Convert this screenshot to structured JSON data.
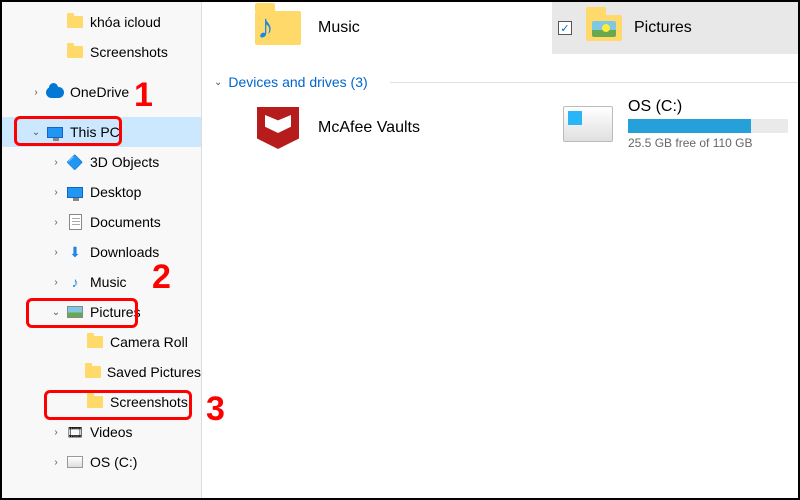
{
  "sidebar": {
    "items": [
      {
        "label": "khóa icloud",
        "indent": 2,
        "icon": "folder",
        "chev": ""
      },
      {
        "label": "Screenshots",
        "indent": 2,
        "icon": "folder",
        "chev": ""
      },
      {
        "label": "OneDrive",
        "indent": 1,
        "icon": "onedrive",
        "chev": "›"
      },
      {
        "label": "This PC",
        "indent": 1,
        "icon": "monitor",
        "chev": "⌄",
        "selected": true
      },
      {
        "label": "3D Objects",
        "indent": 2,
        "icon": "cube",
        "chev": "›"
      },
      {
        "label": "Desktop",
        "indent": 2,
        "icon": "monitor",
        "chev": "›"
      },
      {
        "label": "Documents",
        "indent": 2,
        "icon": "doc",
        "chev": "›"
      },
      {
        "label": "Downloads",
        "indent": 2,
        "icon": "download",
        "chev": "›"
      },
      {
        "label": "Music",
        "indent": 2,
        "icon": "music",
        "chev": "›"
      },
      {
        "label": "Pictures",
        "indent": 2,
        "icon": "pic",
        "chev": "⌄"
      },
      {
        "label": "Camera Roll",
        "indent": 3,
        "icon": "folder",
        "chev": ""
      },
      {
        "label": "Saved Pictures",
        "indent": 3,
        "icon": "folder",
        "chev": ""
      },
      {
        "label": "Screenshots",
        "indent": 3,
        "icon": "folder",
        "chev": ""
      },
      {
        "label": "Videos",
        "indent": 2,
        "icon": "video",
        "chev": "›"
      },
      {
        "label": "OS (C:)",
        "indent": 2,
        "icon": "disk",
        "chev": "›"
      }
    ]
  },
  "main": {
    "music_label": "Music",
    "header_pictures": "Pictures",
    "section_label": "Devices and drives (3)",
    "mcafee_label": "McAfee Vaults",
    "drive": {
      "name": "OS (C:)",
      "free_text": "25.5 GB free of 110 GB",
      "fill_percent": 77
    }
  },
  "annotations": {
    "n1": "1",
    "n2": "2",
    "n3": "3"
  }
}
